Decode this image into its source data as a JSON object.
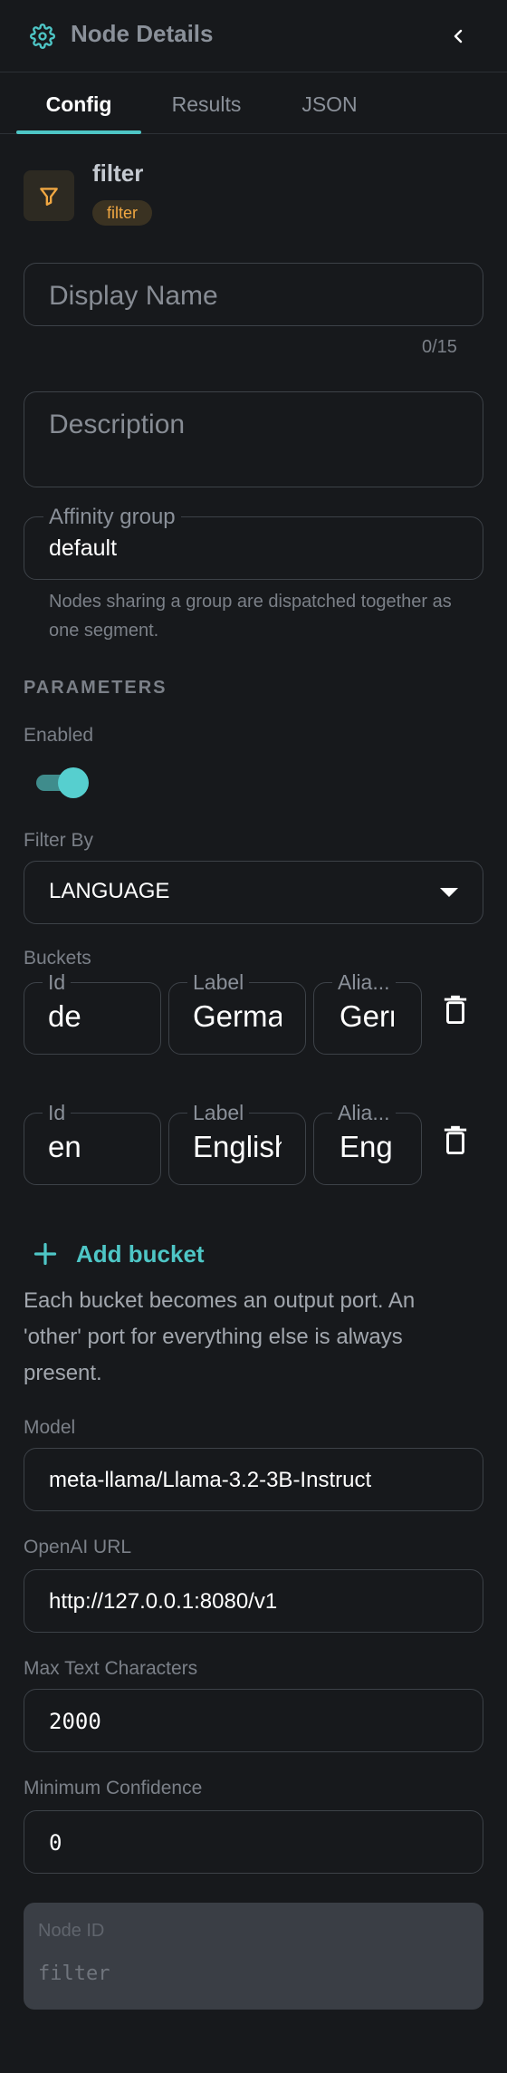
{
  "header": {
    "title": "Node Details",
    "icon": "gear-icon",
    "collapse_icon": "chevron-left-icon"
  },
  "tabs": [
    {
      "label": "Config",
      "active": true
    },
    {
      "label": "Results",
      "active": false
    },
    {
      "label": "JSON",
      "active": false
    }
  ],
  "node": {
    "name": "filter",
    "type_badge": "filter",
    "icon": "filter-funnel-icon",
    "accent_color": "#f0a742"
  },
  "fields": {
    "display_name": {
      "placeholder": "Display Name",
      "value": "",
      "counter": "0/15"
    },
    "description": {
      "placeholder": "Description",
      "value": ""
    },
    "affinity_group": {
      "label": "Affinity group",
      "value": "default",
      "helper": "Nodes sharing a group are dispatched together as one segment."
    }
  },
  "parameters": {
    "section_title": "PARAMETERS",
    "enabled": {
      "label": "Enabled",
      "value": true
    },
    "filter_by": {
      "label": "Filter By",
      "value": "LANGUAGE"
    },
    "buckets": {
      "label": "Buckets",
      "column_labels": {
        "id": "Id",
        "label": "Label",
        "alias": "Alia..."
      },
      "rows": [
        {
          "id": "de",
          "label": "German",
          "alias": "German"
        },
        {
          "id": "en",
          "label": "English",
          "alias": "English"
        }
      ],
      "add_label": "Add bucket",
      "help": "Each bucket becomes an output port. An 'other' port for everything else is always present."
    },
    "model": {
      "label": "Model",
      "value": "meta-llama/Llama-3.2-3B-Instruct"
    },
    "openai_url": {
      "label": "OpenAI URL",
      "value": "http://127.0.0.1:8080/v1"
    },
    "max_text_characters": {
      "label": "Max Text Characters",
      "value": "2000"
    },
    "minimum_confidence": {
      "label": "Minimum Confidence",
      "value": "0"
    }
  },
  "node_id": {
    "label": "Node ID",
    "value": "filter"
  },
  "colors": {
    "background": "#17191c",
    "accent": "#4ec6c6",
    "badge_text": "#f0a742"
  }
}
